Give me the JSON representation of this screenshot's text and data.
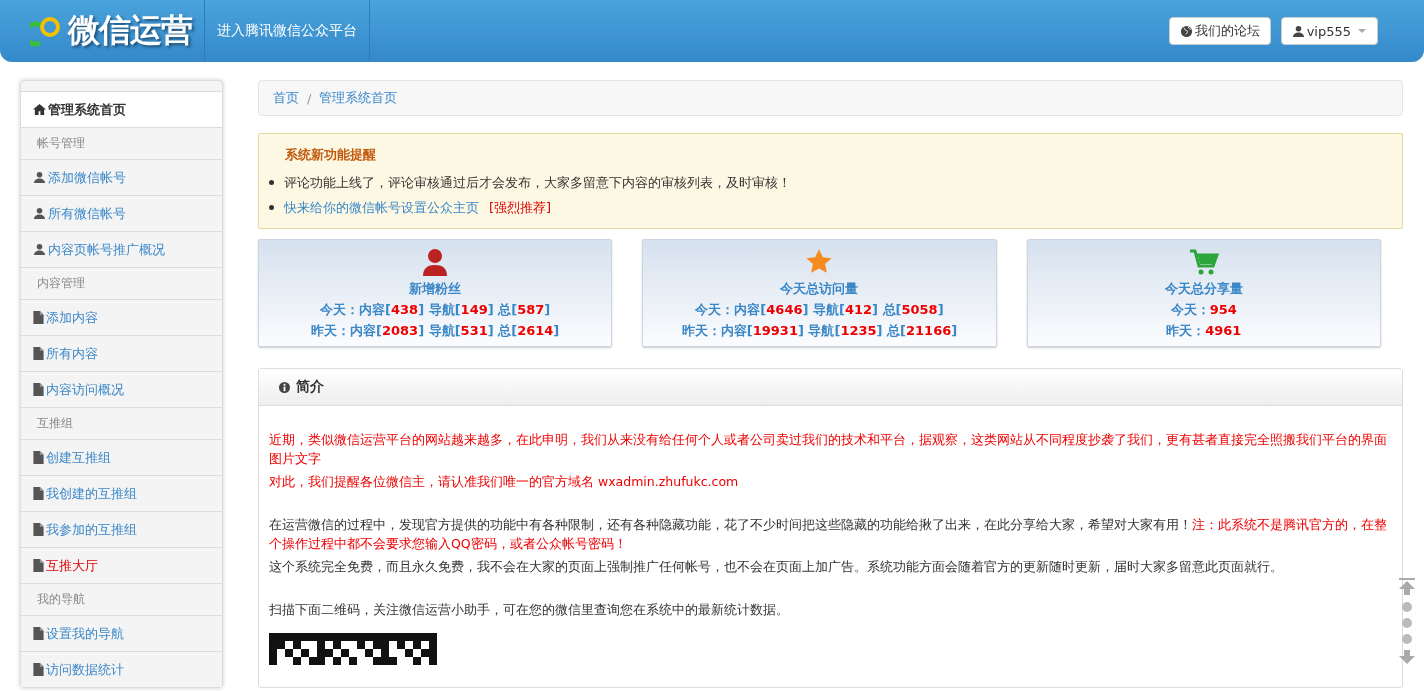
{
  "header": {
    "logo": "微信运营",
    "nav_link": "进入腾讯微信公众平台",
    "buttons": [
      {
        "kind": "globe",
        "label": "我们的论坛"
      },
      {
        "kind": "user",
        "label": "vip555"
      }
    ]
  },
  "sidebar": {
    "items": [
      {
        "kind": "home",
        "label": "管理系统首页",
        "selected": true
      },
      {
        "kind": "header",
        "label": "帐号管理"
      },
      {
        "kind": "user",
        "label": "添加微信帐号",
        "selected": false
      },
      {
        "kind": "user",
        "label": "所有微信帐号",
        "selected": false
      },
      {
        "kind": "user",
        "label": "内容页帐号推广概况",
        "selected": false
      },
      {
        "kind": "header",
        "label": "内容管理"
      },
      {
        "kind": "file",
        "label": "添加内容",
        "selected": false
      },
      {
        "kind": "file",
        "label": "所有内容",
        "selected": false
      },
      {
        "kind": "file",
        "label": "内容访问概况",
        "selected": false
      },
      {
        "kind": "header",
        "label": "互推组"
      },
      {
        "kind": "file",
        "label": "创建互推组",
        "selected": false
      },
      {
        "kind": "file",
        "label": "我创建的互推组",
        "selected": false
      },
      {
        "kind": "file",
        "label": "我参加的互推组",
        "selected": false
      },
      {
        "kind": "file",
        "label": "互推大厅",
        "selected": false,
        "hot": true
      },
      {
        "kind": "header",
        "label": "我的导航"
      },
      {
        "kind": "file",
        "label": "设置我的导航",
        "selected": false
      },
      {
        "kind": "file",
        "label": "访问数据统计",
        "selected": false
      }
    ]
  },
  "breadcrumb": {
    "separator": "/",
    "items": [
      "首页",
      "管理系统首页"
    ]
  },
  "alert": {
    "title": "系统新功能提醒",
    "items": [
      {
        "parts": [
          {
            "text": "评论功能上线了，评论审核通过后才会发布，大家多留意下内容的审核列表，及时审核！",
            "kind": "text"
          }
        ]
      },
      {
        "parts": [
          {
            "text": "快来给你的微信帐号设置公众主页",
            "kind": "link"
          },
          {
            "text": "[强烈推荐]",
            "kind": "warn"
          }
        ]
      }
    ]
  },
  "stats": [
    {
      "kind": "person",
      "title": "新增粉丝",
      "lines": [
        [
          {
            "text": "今天：内容[",
            "kind": "label"
          },
          {
            "text": "438",
            "kind": "value"
          },
          {
            "text": "] 导航[",
            "kind": "label"
          },
          {
            "text": "149",
            "kind": "value"
          },
          {
            "text": "] 总[",
            "kind": "label"
          },
          {
            "text": "587",
            "kind": "value"
          },
          {
            "text": "]",
            "kind": "label"
          }
        ],
        [
          {
            "text": "昨天：内容[",
            "kind": "label"
          },
          {
            "text": "2083",
            "kind": "value"
          },
          {
            "text": "] 导航[",
            "kind": "label"
          },
          {
            "text": "531",
            "kind": "value"
          },
          {
            "text": "] 总[",
            "kind": "label"
          },
          {
            "text": "2614",
            "kind": "value"
          },
          {
            "text": "]",
            "kind": "label"
          }
        ]
      ]
    },
    {
      "kind": "star",
      "title": "今天总访问量",
      "lines": [
        [
          {
            "text": "今天：内容[",
            "kind": "label"
          },
          {
            "text": "4646",
            "kind": "value"
          },
          {
            "text": "] 导航[",
            "kind": "label"
          },
          {
            "text": "412",
            "kind": "value"
          },
          {
            "text": "] 总[",
            "kind": "label"
          },
          {
            "text": "5058",
            "kind": "value"
          },
          {
            "text": "]",
            "kind": "label"
          }
        ],
        [
          {
            "text": "昨天：内容[",
            "kind": "label"
          },
          {
            "text": "19931",
            "kind": "value"
          },
          {
            "text": "] 导航[",
            "kind": "label"
          },
          {
            "text": "1235",
            "kind": "value"
          },
          {
            "text": "] 总[",
            "kind": "label"
          },
          {
            "text": "21166",
            "kind": "value"
          },
          {
            "text": "]",
            "kind": "label"
          }
        ]
      ]
    },
    {
      "kind": "cart",
      "title": "今天总分享量",
      "lines": [
        [
          {
            "text": "今天：",
            "kind": "label"
          },
          {
            "text": "954",
            "kind": "value"
          }
        ],
        [
          {
            "text": "昨天：",
            "kind": "label"
          },
          {
            "text": "4961",
            "kind": "value"
          }
        ]
      ]
    }
  ],
  "panel": {
    "title": "简介",
    "blocks": [
      [
        {
          "parts": [
            {
              "text": "近期，类似微信运营平台的网站越来越多，在此申明，我们从来没有给任何个人或者公司卖过我们的技术和平台，据观察，这类网站从不同程度抄袭了我们，更有甚者直接完全照搬我们平台的界面图片文字",
              "warn": true
            }
          ]
        },
        {
          "parts": [
            {
              "text": "对此，我们提醒各位微信主，请认准我们唯一的官方域名 wxadmin.zhufukc.com",
              "warn": true
            }
          ]
        }
      ],
      [
        {
          "parts": [
            {
              "text": "在运营微信的过程中，发现官方提供的功能中有各种限制，还有各种隐藏功能，花了不少时间把这些隐藏的功能给揪了出来，在此分享给大家，希望对大家有用！",
              "warn": false
            },
            {
              "text": "注：此系统不是腾讯官方的，在整个操作过程中都不会要求您输入QQ密码，或者公众帐号密码！",
              "warn": true
            }
          ]
        },
        {
          "parts": [
            {
              "text": "这个系统完全免费，而且永久免费，我不会在大家的页面上强制推广任何帐号，也不会在页面上加广告。系统功能方面会随着官方的更新随时更新，届时大家多留意此页面就行。",
              "warn": false
            }
          ]
        }
      ],
      [
        {
          "parts": [
            {
              "text": "扫描下面二维码，关注微信运营小助手，可在您的微信里查询您在系统中的最新统计数据。",
              "warn": false
            }
          ]
        }
      ]
    ]
  }
}
